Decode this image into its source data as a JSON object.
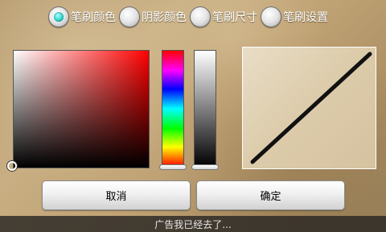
{
  "tabs": [
    {
      "label": "笔刷颜色",
      "selected": true
    },
    {
      "label": "阴影颜色",
      "selected": false
    },
    {
      "label": "笔刷尺寸",
      "selected": false
    },
    {
      "label": "笔刷设置",
      "selected": false
    }
  ],
  "color_picker": {
    "base_hue": "#ff0000",
    "hue_bar": [
      "#ff0000",
      "#ff00ff",
      "#0000ff",
      "#00ffff",
      "#00ff00",
      "#ffff00",
      "#ff0000"
    ],
    "value_bar": [
      "#ffffff",
      "#000000"
    ],
    "selected_color": "#000000"
  },
  "preview": {
    "stroke_color": "#111111"
  },
  "buttons": {
    "cancel": "取消",
    "confirm": "确定"
  },
  "status_bar": {
    "text": "广告我已经去了..."
  }
}
